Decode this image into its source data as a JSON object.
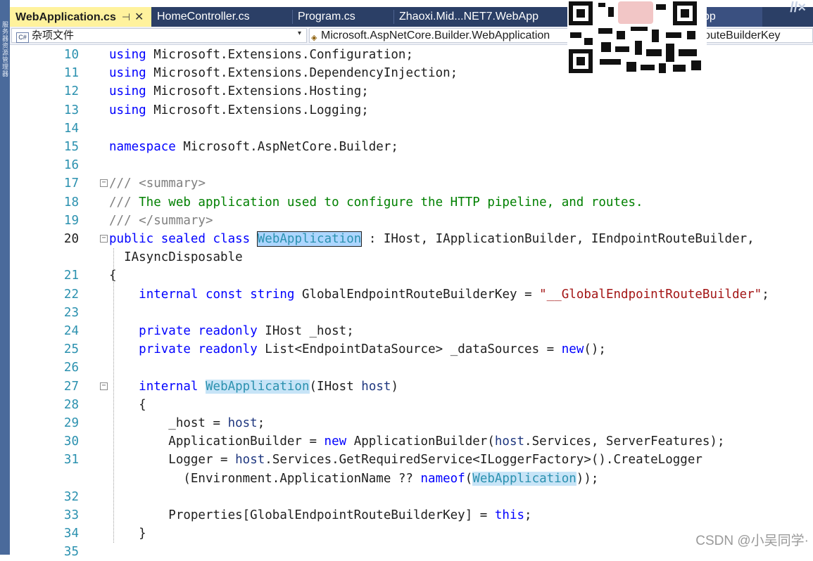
{
  "tabs": [
    {
      "label": "WebApplication.cs",
      "active": true
    },
    {
      "label": "HomeController.cs"
    },
    {
      "label": "Program.cs"
    },
    {
      "label": "Zhaoxi.Mid...NET7.WebApp"
    },
    {
      "label": "pp"
    }
  ],
  "tab_icons": {
    "pin": "pin-icon",
    "close": "close-icon"
  },
  "navbar": {
    "project": "杂项文件",
    "project_icon": "csharp-file-icon",
    "class": "Microsoft.AspNetCore.Builder.WebApplication",
    "class_icon": "class-icon",
    "member": "outeBuilderKey"
  },
  "code_lines": [
    {
      "num": "10",
      "html": "<span class=\"kw\">using</span> Microsoft.Extensions.Configuration;"
    },
    {
      "num": "11",
      "html": "<span class=\"kw\">using</span> Microsoft.Extensions.DependencyInjection;"
    },
    {
      "num": "12",
      "html": "<span class=\"kw\">using</span> Microsoft.Extensions.Hosting;"
    },
    {
      "num": "13",
      "html": "<span class=\"kw\">using</span> Microsoft.Extensions.Logging;"
    },
    {
      "num": "14",
      "html": ""
    },
    {
      "num": "15",
      "html": "<span class=\"kw\">namespace</span> Microsoft.AspNetCore.Builder;"
    },
    {
      "num": "16",
      "html": ""
    },
    {
      "num": "17",
      "html": "<span class=\"xml\">///</span> <span class=\"xml\">&lt;summary&gt;</span>",
      "fold": true
    },
    {
      "num": "18",
      "html": "<span class=\"xml\">///</span><span class=\"cm\"> The web application used to configure the HTTP pipeline, and routes.</span>"
    },
    {
      "num": "19",
      "html": "<span class=\"xml\">/// &lt;/summary&gt;</span>"
    },
    {
      "num": "20",
      "html": "<span class=\"kw\">public</span> <span class=\"kw\">sealed</span> <span class=\"kw\">class</span> <span class=\"ty sel\">WebApplication</span> : IHost, IApplicationBuilder, IEndpointRouteBuilder,",
      "fold": true,
      "current": true
    },
    {
      "num": "",
      "html": "  IAsyncDisposable"
    },
    {
      "num": "21",
      "html": "{"
    },
    {
      "num": "22",
      "html": "    <span class=\"kw\">internal</span> <span class=\"kw\">const</span> <span class=\"kw\">string</span> GlobalEndpointRouteBuilderKey = <span class=\"st\">\"__GlobalEndpointRouteBuilder\"</span>;"
    },
    {
      "num": "23",
      "html": ""
    },
    {
      "num": "24",
      "html": "    <span class=\"kw\">private</span> <span class=\"kw\">readonly</span> IHost _host;"
    },
    {
      "num": "25",
      "html": "    <span class=\"kw\">private</span> <span class=\"kw\">readonly</span> List&lt;EndpointDataSource&gt; _dataSources = <span class=\"kw\">new</span>();"
    },
    {
      "num": "26",
      "html": ""
    },
    {
      "num": "27",
      "html": "    <span class=\"kw\">internal</span> <span class=\"ty hl\">WebApplication</span>(IHost <span class=\"pa\">host</span>)",
      "fold": true
    },
    {
      "num": "28",
      "html": "    {"
    },
    {
      "num": "29",
      "html": "        _host = <span class=\"pa\">host</span>;"
    },
    {
      "num": "30",
      "html": "        ApplicationBuilder = <span class=\"kw\">new</span> ApplicationBuilder(<span class=\"pa\">host</span>.Services, ServerFeatures);"
    },
    {
      "num": "31",
      "html": "        Logger = <span class=\"pa\">host</span>.Services.GetRequiredService&lt;ILoggerFactory&gt;().CreateLogger"
    },
    {
      "num": "",
      "html": "          (Environment.ApplicationName ?? <span class=\"kw\">nameof</span>(<span class=\"ty hl\">WebApplication</span>));"
    },
    {
      "num": "32",
      "html": ""
    },
    {
      "num": "33",
      "html": "        Properties[GlobalEndpointRouteBuilderKey] = <span class=\"kw\">this</span>;"
    },
    {
      "num": "34",
      "html": "    }"
    },
    {
      "num": "35",
      "html": ""
    }
  ],
  "watermark": "CSDN @小吴同学·"
}
